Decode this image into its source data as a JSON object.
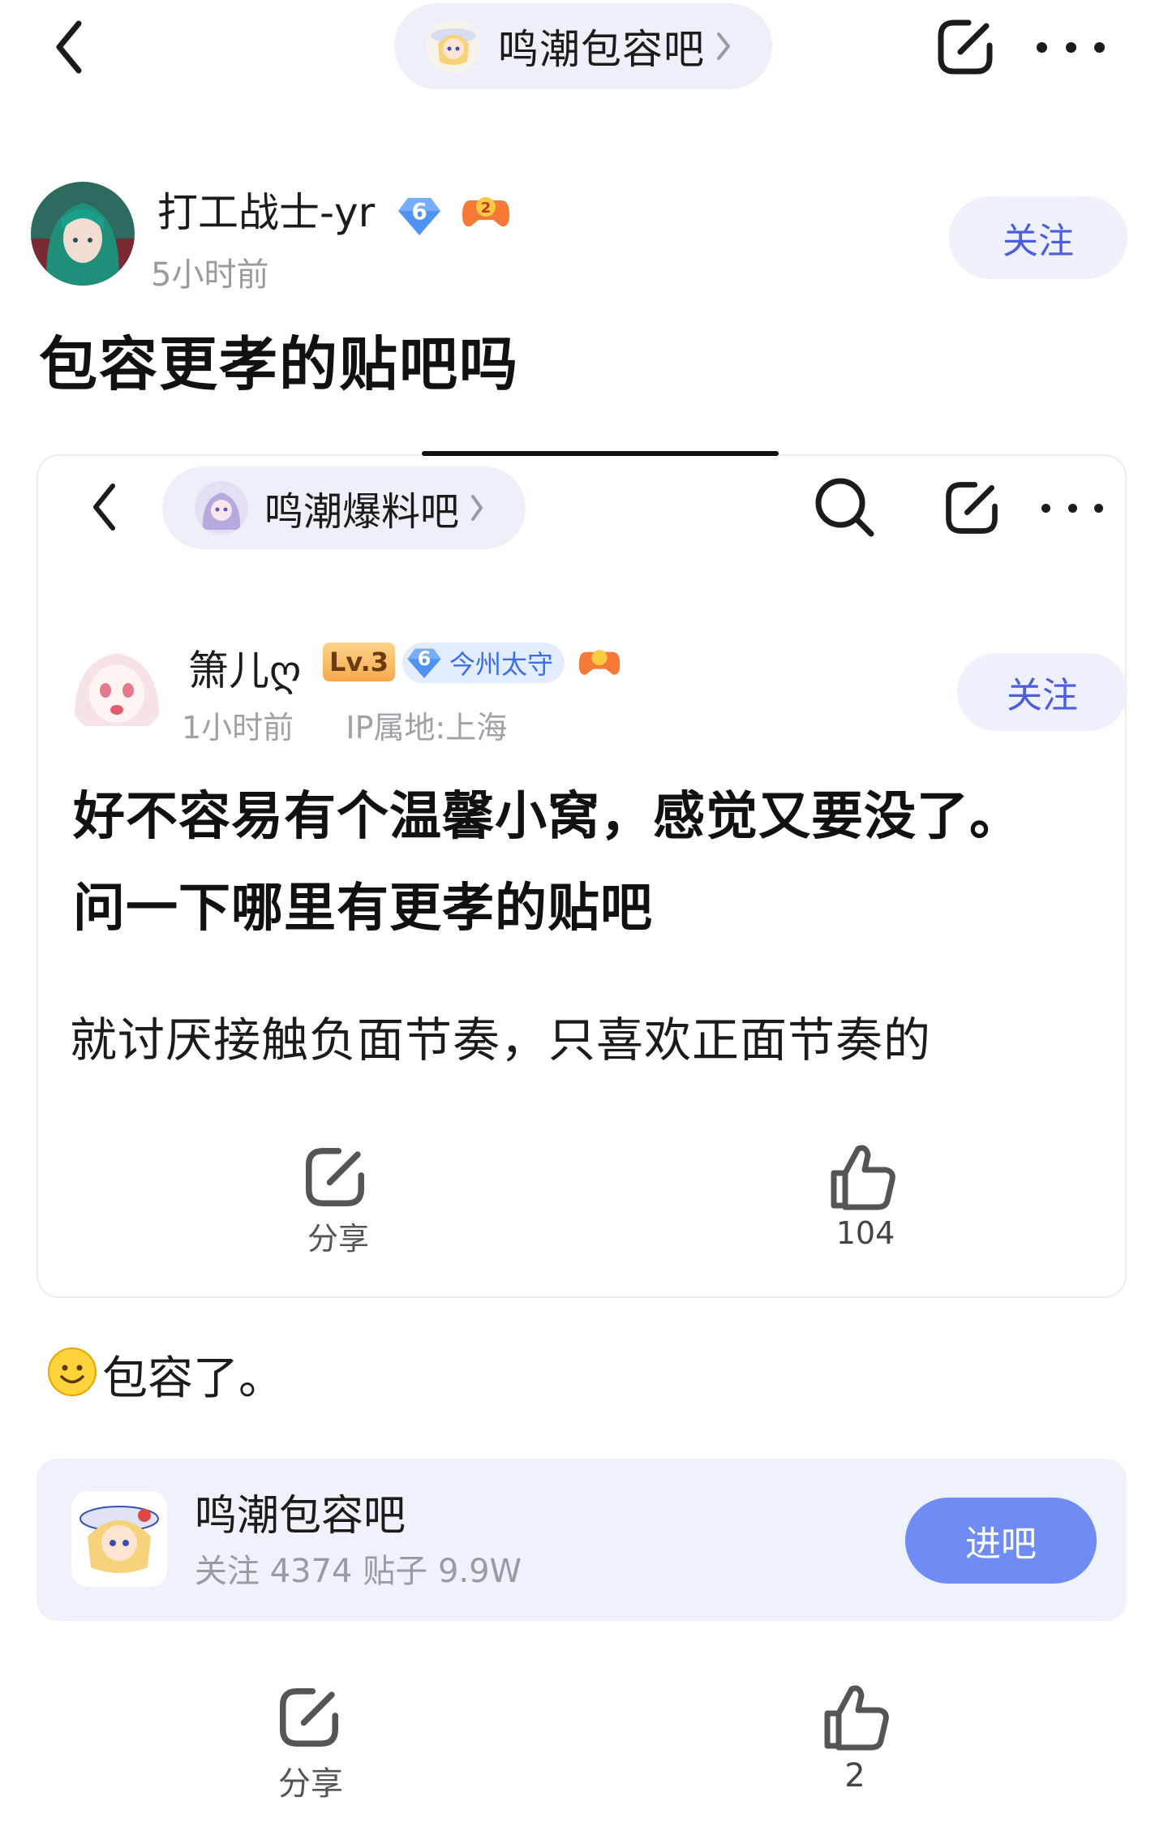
{
  "topbar": {
    "forum_name": "鸣潮包容吧"
  },
  "post": {
    "author_name": "打工战士-yr",
    "author_level": "6",
    "time": "5小时前",
    "follow_label": "关注",
    "title": "包容更孝的贴吧吗"
  },
  "embedded": {
    "forum_name": "鸣潮爆料吧",
    "author_name": "箫儿ღ",
    "level_badge": "Lv.3",
    "rank_level": "6",
    "rank_title": "今州太守",
    "time": "1小时前",
    "ip": "IP属地:上海",
    "follow_label": "关注",
    "text_line1": "好不容易有个温馨小窝，感觉又要没了。",
    "text_line2": "问一下哪里有更孝的贴吧",
    "text_line3": "就讨厌接触负面节奏，只喜欢正面节奏的",
    "share_label": "分享",
    "like_count": "104"
  },
  "reply": {
    "text": "包容了。"
  },
  "forum_card": {
    "name": "鸣潮包容吧",
    "stats": "关注 4374   贴子 9.9W",
    "enter_label": "进吧"
  },
  "actions": {
    "share_label": "分享",
    "like_count": "2"
  },
  "colors": {
    "accent": "#4d5de0",
    "enter_button": "#6f8cf5",
    "pill_bg": "#eef0f9",
    "muted_text": "#9a9aa2"
  },
  "icons": [
    "back-icon",
    "chevron-right-icon",
    "share-icon",
    "more-icon",
    "search-icon",
    "like-icon",
    "level-diamond-icon",
    "gamepad-badge-icon",
    "smile-emoji-icon"
  ]
}
